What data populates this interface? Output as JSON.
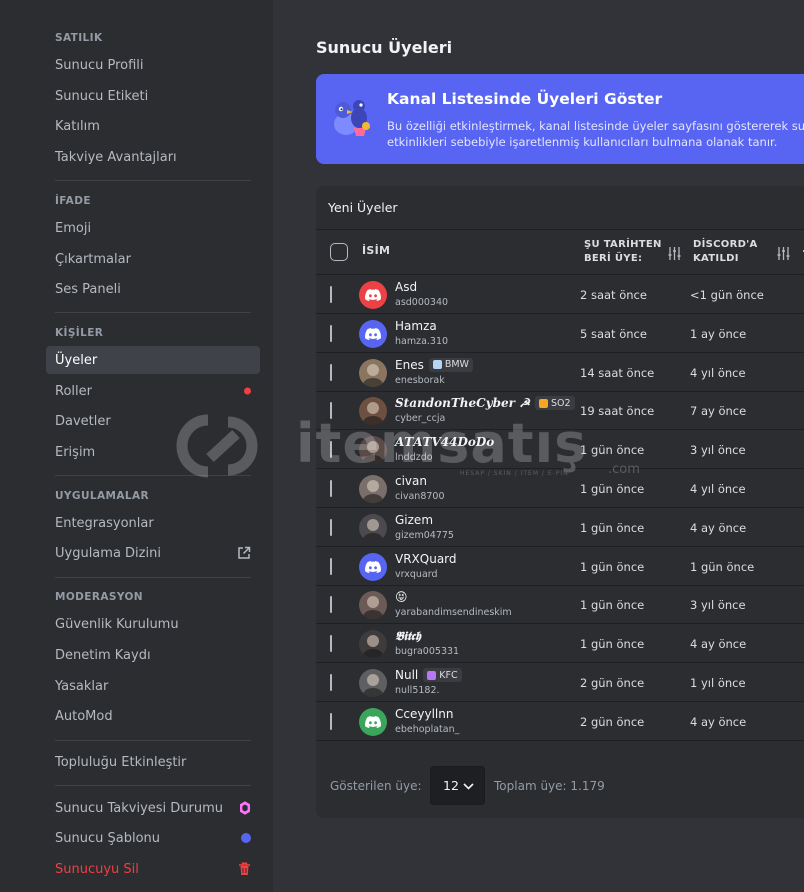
{
  "sidebar": {
    "sections": [
      {
        "title": "SATILIK",
        "items": [
          "Sunucu Profili",
          "Sunucu Etiketi",
          "Katılım",
          "Takviye Avantajları"
        ]
      },
      {
        "title": "İFADE",
        "items": [
          "Emoji",
          "Çıkartmalar",
          "Ses Paneli"
        ]
      },
      {
        "title": "KİŞİLER",
        "items": [
          "Üyeler",
          "Roller",
          "Davetler",
          "Erişim"
        ]
      },
      {
        "title": "UYGULAMALAR",
        "items": [
          "Entegrasyonlar",
          "Uygulama Dizini"
        ]
      },
      {
        "title": "MODERASYON",
        "items": [
          "Güvenlik Kurulumu",
          "Denetim Kaydı",
          "Yasaklar",
          "AutoMod"
        ]
      }
    ],
    "community": "Topluluğu Etkinleştir",
    "boost_status": "Sunucu Takviyesi Durumu",
    "template": "Sunucu Şablonu",
    "delete": "Sunucuyu Sil",
    "active_item": "Üyeler"
  },
  "main": {
    "title": "Sunucu Üyeleri",
    "banner": {
      "title": "Kanal Listesinde Üyeleri Göster",
      "text": "Bu özelliği etkinleştirmek, kanal listesinde üyeler sayfasını göstererek sunu etkinlikleri sebebiyle işaretlenmiş kullanıcıları bulmana olanak tanır."
    },
    "table": {
      "title": "Yeni Üyeler",
      "headers": {
        "name": "İSİM",
        "joined_server": "ŞU TARİHTEN BERİ ÜYE:",
        "joined_discord": "DİSCORD'A KATILDI"
      },
      "rows": [
        {
          "name": "Asd",
          "username": "asd000340",
          "since": "2 saat önce",
          "discord": "<1 gün önce",
          "avatar": "discord-red"
        },
        {
          "name": "Hamza",
          "username": "hamza.310",
          "since": "5 saat önce",
          "discord": "1 ay önce",
          "avatar": "discord-blue"
        },
        {
          "name": "Enes",
          "username": "enesborak",
          "since": "14 saat önce",
          "discord": "4 yıl önce",
          "avatar": "photo",
          "tag": "BMW"
        },
        {
          "name": "𝑺𝒕𝒂𝒏𝒅𝒐𝒏𝑻𝒉𝒆𝑪𝒚𝒃𝒆𝒓 ☭",
          "username": "cyber_ccja",
          "since": "19 saat önce",
          "discord": "7 ay önce",
          "avatar": "photo",
          "tag": "SO2"
        },
        {
          "name": "𝑨𝑻𝑨𝑻𝑽44𝑫𝒐𝑫𝒐",
          "username": "lnddzdo",
          "since": "1 gün önce",
          "discord": "3 yıl önce",
          "avatar": "photo"
        },
        {
          "name": "civan",
          "username": "civan8700",
          "since": "1 gün önce",
          "discord": "4 yıl önce",
          "avatar": "photo"
        },
        {
          "name": "Gizem",
          "username": "gizem04775",
          "since": "1 gün önce",
          "discord": "4 ay önce",
          "avatar": "photo"
        },
        {
          "name": "VRXQuard",
          "username": "vrxquard",
          "since": "1 gün önce",
          "discord": "1 gün önce",
          "avatar": "discord-blue"
        },
        {
          "name": "😝",
          "username": "yarabandimsendineskim",
          "since": "1 gün önce",
          "discord": "3 yıl önce",
          "avatar": "photo"
        },
        {
          "name": "𝕭𝖎𝖙𝖈𝖍",
          "username": "bugra005331",
          "since": "1 gün önce",
          "discord": "4 ay önce",
          "avatar": "photo"
        },
        {
          "name": "Null",
          "username": "null5182.",
          "since": "2 gün önce",
          "discord": "1 yıl önce",
          "avatar": "photo",
          "tag": "KFC"
        },
        {
          "name": "Cceyyllnn",
          "username": "ebehoplatan_",
          "since": "2 gün önce",
          "discord": "4 ay önce",
          "avatar": "discord-green"
        }
      ]
    },
    "footer": {
      "label": "Gösterilen üye:",
      "page_size": "12",
      "total": "Toplam üye: 1.179"
    }
  },
  "watermark": {
    "text": "itemsatış",
    "sub": "HESAP / SKIN / ITEM / E-PIN",
    "domain": ".com"
  },
  "colors": {
    "accent": "#5865f2",
    "danger": "#f23f42",
    "boost": "#ff73fa",
    "sidebar_bg": "#2b2d31",
    "main_bg": "#313338"
  }
}
